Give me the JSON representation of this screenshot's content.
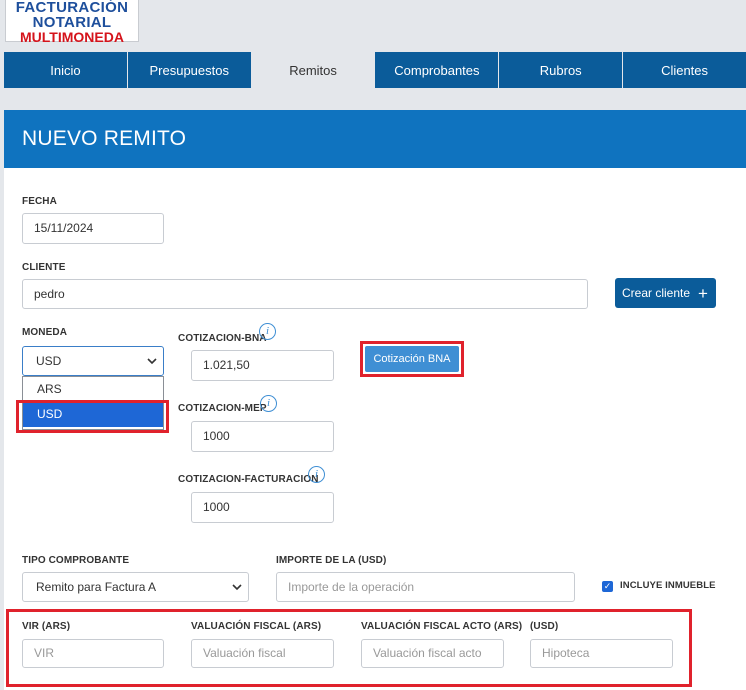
{
  "logo": {
    "line1": "FACTURACIÓN",
    "line2": "NOTARIAL",
    "line3": "MULTIMONEDA"
  },
  "nav": [
    "Inicio",
    "Presupuestos",
    "Remitos",
    "Comprobantes",
    "Rubros",
    "Clientes"
  ],
  "nav_active": "Remitos",
  "page_title": "NUEVO REMITO",
  "form": {
    "fecha": {
      "label": "FECHA",
      "value": "15/11/2024"
    },
    "cliente": {
      "label": "CLIENTE",
      "value": "pedro"
    },
    "crear_cliente": {
      "label": "Crear cliente",
      "icon": "plus-icon"
    },
    "moneda": {
      "label": "MONEDA",
      "value": "USD",
      "options": [
        "ARS",
        "USD"
      ],
      "selected": "USD"
    },
    "cotizacion_bna": {
      "label": "COTIZACION-BNA",
      "value": "1.021,50"
    },
    "cotizacion_bna_button": "Cotización BNA",
    "cotizacion_mep": {
      "label": "COTIZACION-MEP",
      "value": "1000"
    },
    "cotizacion_facturacion": {
      "label": "COTIZACION-FACTURACION",
      "value": "1000"
    },
    "tipo_comprobante": {
      "label": "TIPO COMPROBANTE",
      "value": "Remito para Factura A"
    },
    "importe": {
      "label": "IMPORTE DE LA (USD)",
      "placeholder": "Importe de la operación"
    },
    "incluye_inmueble": {
      "label": "INCLUYE INMUEBLE",
      "checked": true
    },
    "vir": {
      "label": "VIR (ARS)",
      "placeholder": "VIR"
    },
    "valuacion_fiscal": {
      "label": "VALUACIÓN FISCAL (ARS)",
      "placeholder": "Valuación fiscal"
    },
    "valuacion_fiscal_acto": {
      "label": "VALUACIÓN FISCAL ACTO (ARS)",
      "placeholder": "Valuación fiscal acto"
    },
    "hipoteca": {
      "label": "(USD)",
      "placeholder": "Hipoteca"
    }
  },
  "colors": {
    "nav": "#0b5c9a",
    "header": "#0f73bf",
    "highlight": "#e0222c",
    "accent": "#1e67d6"
  }
}
